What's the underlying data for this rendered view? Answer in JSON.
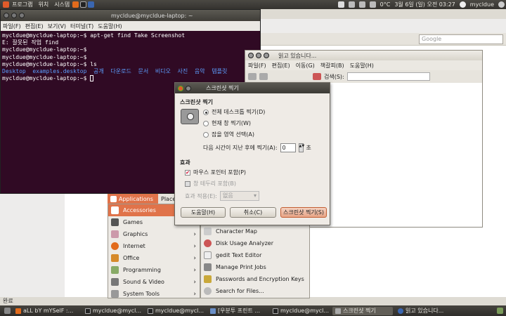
{
  "top_panel": {
    "menus": [
      "프로그램",
      "위치",
      "시스템"
    ],
    "temp": "0°C",
    "datetime": "3월 6일 (일) 오전 03:27",
    "user": "mycldue"
  },
  "firefox": {
    "google_placeholder": "Google",
    "status": "완료"
  },
  "terminal": {
    "title": "mycldue@mycldue-laptop: ~",
    "menu": [
      "파일(F)",
      "편집(E)",
      "보기(V)",
      "터미널(T)",
      "도움말(H)"
    ],
    "lines": [
      "mycldue@mycldue-laptop:~$ apt-get find Take Screenshot",
      "E: 잘못된 작업 find",
      "mycldue@mycldue-laptop:~$",
      "mycldue@mycldue-laptop:~$",
      "mycldue@mycldue-laptop:~$ ls"
    ],
    "ls_output": "Desktop  examples.desktop  공개  다운로드  문서  비디오  사진  음악  템플릿",
    "prompt": "mycldue@mycldue-laptop:~$ "
  },
  "readwin": {
    "title": "읽고 있습니다...",
    "menu": [
      "파일(F)",
      "편집(E)",
      "이동(G)",
      "책갈피(B)",
      "도움말(H)"
    ],
    "search_label": "검색(S):"
  },
  "appmenu": {
    "tabs": [
      "Applications",
      "Places"
    ],
    "items": [
      "Accessories",
      "Games",
      "Graphics",
      "Internet",
      "Office",
      "Programming",
      "Sound & Video",
      "System Tools"
    ],
    "sub": [
      "Character Map",
      "Disk Usage Analyzer",
      "gedit Text Editor",
      "Manage Print Jobs",
      "Passwords and Encryption Keys",
      "Search for Files..."
    ]
  },
  "dialog": {
    "title": "스크린샷 찍기",
    "section1": "스크린샷 찍기",
    "opt_full": "전체 데스크톱 찍기(D)",
    "opt_window": "현재 창 찍기(W)",
    "opt_area": "잡을 영역 선택(A)",
    "delay_label": "다음 시간이 지난 후에 찍기(A):",
    "delay_value": "0",
    "delay_unit": "초",
    "section2": "효과",
    "pointer": "마우스 포인터 포함(P)",
    "border": "창 테두리 포함(B)",
    "effect_label": "효과 적용(E):",
    "effect_value": "없음",
    "btn_help": "도움말(H)",
    "btn_cancel": "취소(C)",
    "btn_take": "스크린샷 찍기(S)"
  },
  "taskbar": [
    "aLL bY mYSelF :...",
    "mycldue@mycl...",
    "mycldue@mycl...",
    "[우분투 프린트 ...",
    "mycldue@mycl...",
    "스크린샷 찍기",
    "읽고 있습니다..."
  ],
  "colors": {
    "terminal_bg": "#300a24",
    "accent": "#e0734a",
    "panel": "#3c3b37"
  }
}
